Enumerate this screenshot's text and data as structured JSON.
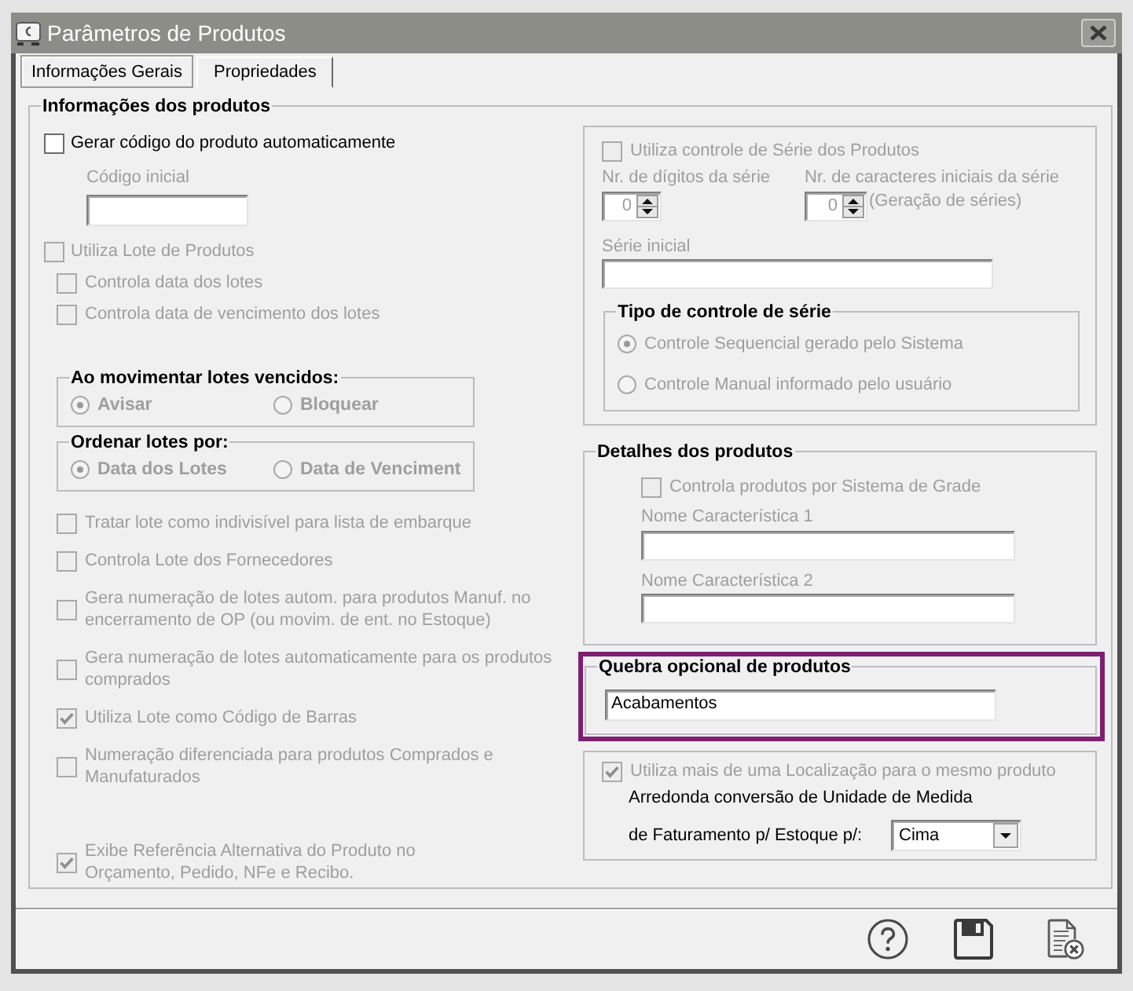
{
  "window": {
    "title": "Parâmetros de Produtos"
  },
  "tabs": [
    {
      "label": "Informações Gerais",
      "selected": true
    },
    {
      "label": "Propriedades",
      "selected": false
    }
  ],
  "product_info": {
    "title": "Informações dos produtos",
    "options": [
      {
        "kind": "checkbox",
        "label": "Gerar código do produto automaticamente",
        "checked": false,
        "disabled": false,
        "children": [
          {
            "kind": "text_field",
            "label": "Código inicial",
            "disabled": true
          }
        ]
      },
      {
        "kind": "checkbox",
        "label": "Utiliza Lote de Produtos",
        "checked": false,
        "disabled": true,
        "children": [
          {
            "kind": "checkbox",
            "label": "Controla data dos lotes",
            "checked": false,
            "disabled": true
          },
          {
            "kind": "checkbox",
            "label": "Controla data de vencimento dos lotes",
            "checked": false,
            "disabled": true
          },
          {
            "kind": "radio_group",
            "title": "Ao movimentar lotes vencidos:",
            "disabled": true,
            "options": [
              {
                "label": "Avisar",
                "selected": true
              },
              {
                "label": "Bloquear",
                "selected": false
              }
            ]
          },
          {
            "kind": "radio_group",
            "title": "Ordenar lotes por:",
            "disabled": true,
            "options": [
              {
                "label": "Data dos Lotes",
                "selected": true
              },
              {
                "label": "Data de Venciment",
                "selected": false
              }
            ]
          },
          {
            "kind": "checkbox",
            "label": "Tratar lote como indivisível para lista de embarque",
            "checked": false,
            "disabled": true
          },
          {
            "kind": "checkbox",
            "label": "Controla Lote dos Fornecedores",
            "checked": false,
            "disabled": true
          },
          {
            "kind": "checkbox",
            "label": "Gera numeração de lotes autom. para produtos Manuf. no\nencerramento de OP (ou movim. de ent. no Estoque)",
            "checked": false,
            "disabled": true
          },
          {
            "kind": "checkbox",
            "label": "Gera numeração de lotes automaticamente para os produtos\ncomprados",
            "checked": false,
            "disabled": true
          },
          {
            "kind": "checkbox",
            "label": "Utiliza Lote como Código de Barras",
            "checked": true,
            "disabled": true
          },
          {
            "kind": "checkbox",
            "label": "Numeração diferenciada para produtos Comprados e\nManufaturados",
            "checked": false,
            "disabled": true
          },
          {
            "kind": "checkbox",
            "label": "Exibe Referência Alternativa do Produto no\nOrçamento, Pedido, NFe e Recibo.",
            "checked": true,
            "disabled": true
          }
        ]
      }
    ],
    "serial": {
      "checkbox": {
        "label": "Utiliza controle de Série dos Produtos",
        "checked": false,
        "disabled": true
      },
      "spinners": [
        {
          "label": "Nr. de dígitos da série",
          "value": "0",
          "disabled": true
        },
        {
          "label": "Nr. de caracteres iniciais da série",
          "note": "(Geração de séries)",
          "value": "0",
          "disabled": true
        }
      ],
      "initial_serial": {
        "label": "Série inicial",
        "disabled": true
      },
      "serial_type": {
        "title": "Tipo de controle de série",
        "disabled": true,
        "options": [
          {
            "label": "Controle Sequencial gerado pelo Sistema",
            "selected": true
          },
          {
            "label": "Controle Manual informado pelo usuário",
            "selected": false
          }
        ]
      }
    },
    "details": {
      "title": "Detalhes dos produtos",
      "checkbox": {
        "label": "Controla produtos por Sistema de Grade",
        "checked": false,
        "disabled": true
      },
      "fields": [
        {
          "label": "Nome Característica 1",
          "disabled": true
        },
        {
          "label": "Nome Característica 2",
          "disabled": true
        }
      ]
    },
    "optional_break": {
      "title": "Quebra opcional de produtos",
      "value": "Acabamentos",
      "highlighted": true
    },
    "location": {
      "checkbox": {
        "label": "Utiliza mais de uma Localização para o mesmo produto",
        "checked": true,
        "disabled": true
      },
      "rounding_label": "Arredonda conversão de Unidade de Medida",
      "rounding_field": {
        "label": "de Faturamento p/ Estoque p/:",
        "value": "Cima"
      }
    }
  }
}
